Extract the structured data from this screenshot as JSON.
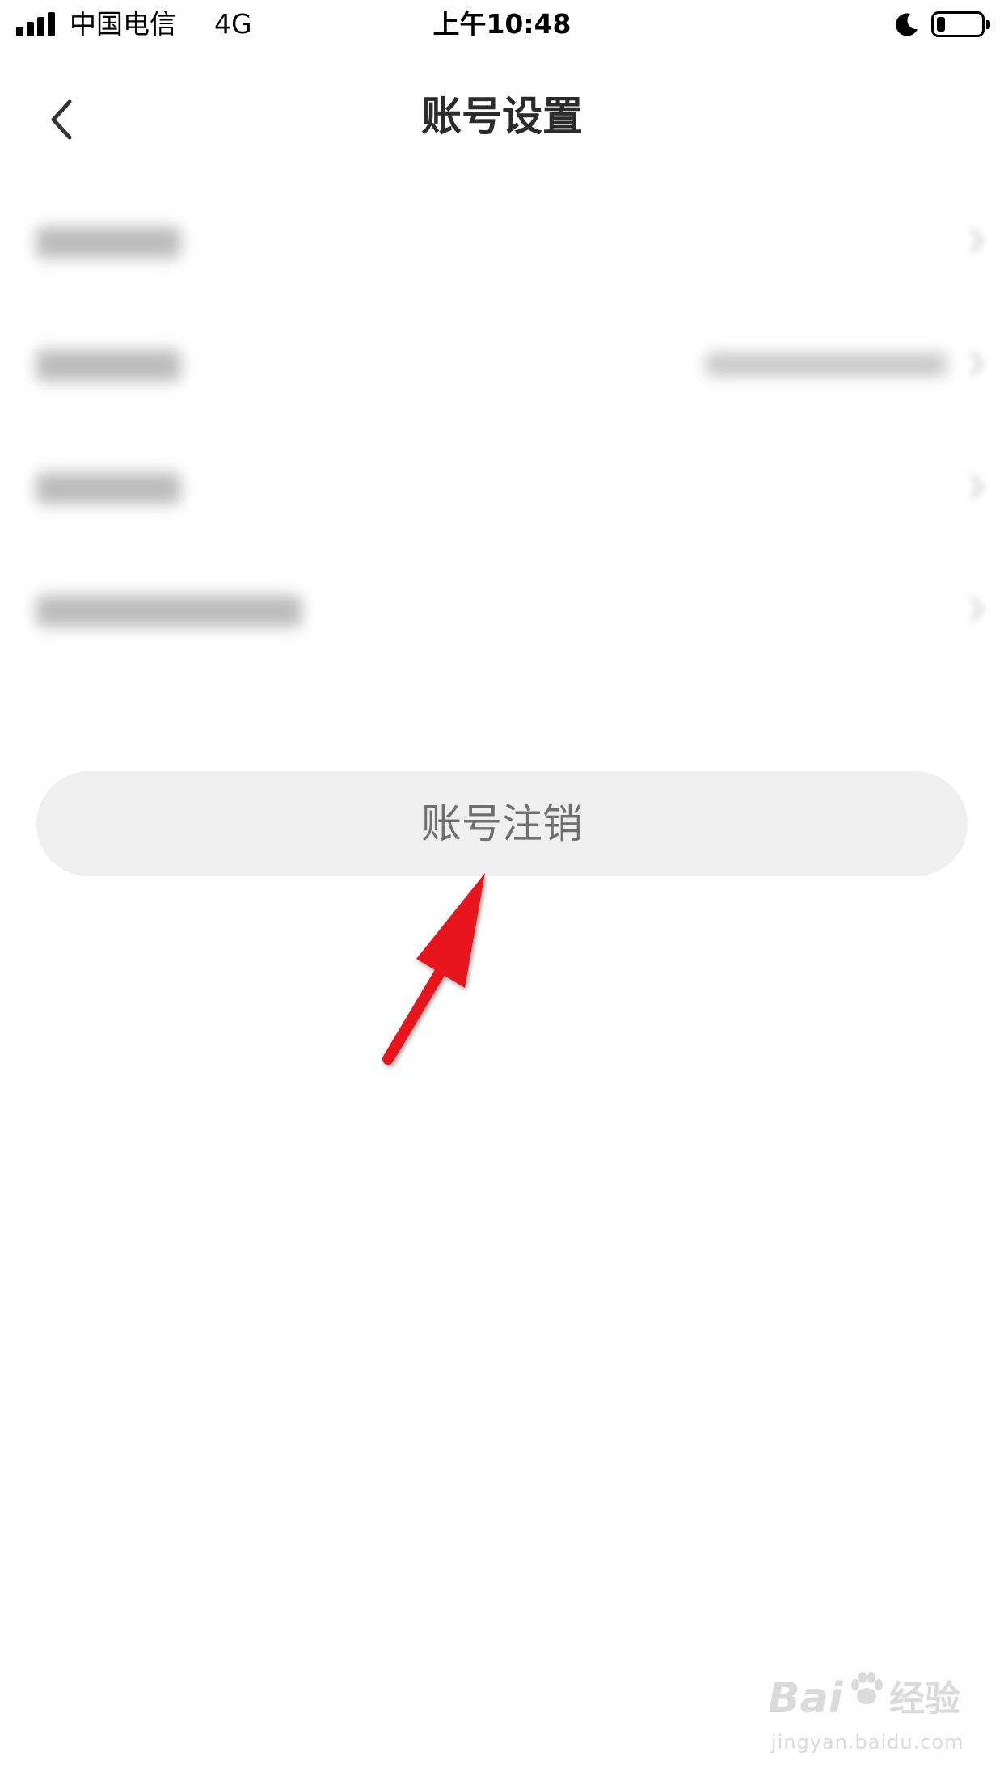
{
  "status_bar": {
    "carrier": "中国电信",
    "network": "4G",
    "time": "上午10:48",
    "icons": [
      "signal-icon",
      "moon-icon",
      "battery-icon"
    ]
  },
  "nav": {
    "title": "账号设置",
    "back_icon": "chevron-left-icon"
  },
  "settings_list": {
    "note": "",
    "rows": [
      {
        "label": "",
        "value": ""
      },
      {
        "label": "",
        "value": ""
      },
      {
        "label": "",
        "value": ""
      },
      {
        "label": "",
        "value": ""
      }
    ]
  },
  "cancel_account": {
    "label": "账号注销"
  },
  "annotation": {
    "icon": "red-arrow-icon",
    "color": "#e8121b"
  },
  "watermark": {
    "brand": "Bai",
    "brand_suffix": "经验",
    "url": "jingyan.baidu.com"
  },
  "colors": {
    "background": "#ffffff",
    "button_bg": "#efefef",
    "button_text": "#6f6f6f",
    "title_text": "#2b2b2b"
  }
}
